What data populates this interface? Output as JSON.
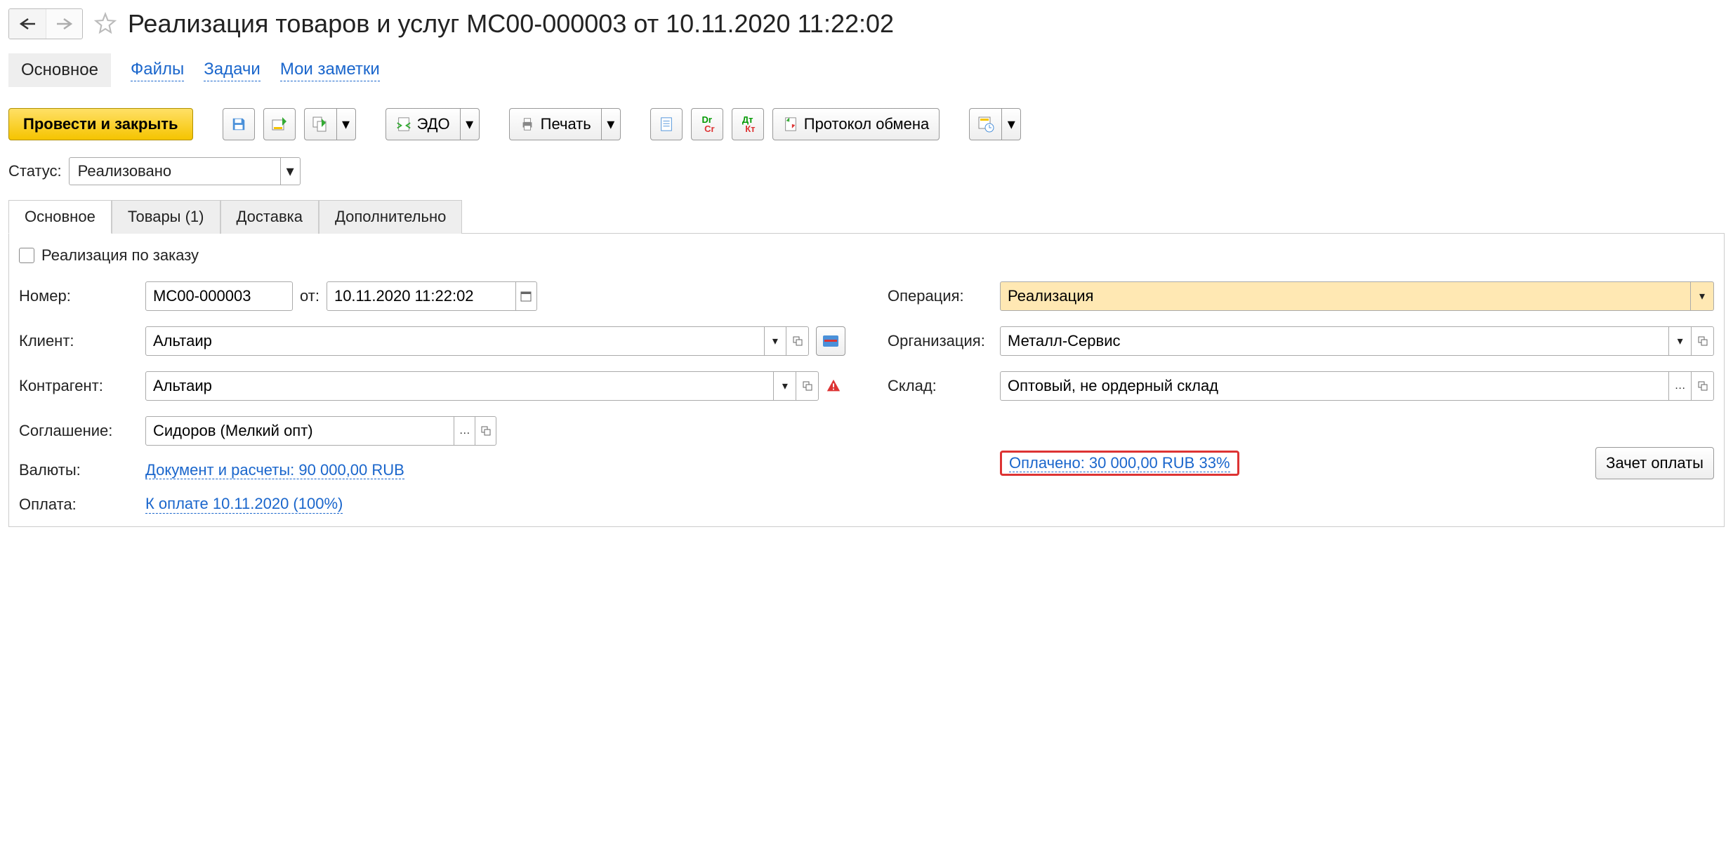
{
  "header": {
    "title": "Реализация товаров и услуг МС00-000003 от 10.11.2020 11:22:02"
  },
  "top_nav": {
    "main": "Основное",
    "files": "Файлы",
    "tasks": "Задачи",
    "notes": "Мои заметки"
  },
  "toolbar": {
    "post_close": "Провести и закрыть",
    "edo": "ЭДО",
    "print": "Печать",
    "exchange": "Протокол обмена"
  },
  "status": {
    "label": "Статус:",
    "value": "Реализовано"
  },
  "tabs": {
    "main": "Основное",
    "goods": "Товары (1)",
    "delivery": "Доставка",
    "extra": "Дополнительно"
  },
  "form": {
    "by_order_label": "Реализация по заказу",
    "number_label": "Номер:",
    "number": "МС00-000003",
    "from_label": "от:",
    "date": "10.11.2020 11:22:02",
    "client_label": "Клиент:",
    "client": "Альтаир",
    "counterparty_label": "Контрагент:",
    "counterparty": "Альтаир",
    "agreement_label": "Соглашение:",
    "agreement": "Сидоров (Мелкий опт)",
    "currency_label": "Валюты:",
    "currency_link": "Документ и расчеты: 90 000,00 RUB",
    "payment_label": "Оплата:",
    "to_pay_link": "К оплате 10.11.2020 (100%)",
    "paid_link": "Оплачено: 30 000,00 RUB  33%",
    "offset_btn": "Зачет оплаты",
    "operation_label": "Операция:",
    "operation": "Реализация",
    "org_label": "Организация:",
    "org": "Металл-Сервис",
    "warehouse_label": "Склад:",
    "warehouse": "Оптовый, не ордерный склад"
  }
}
